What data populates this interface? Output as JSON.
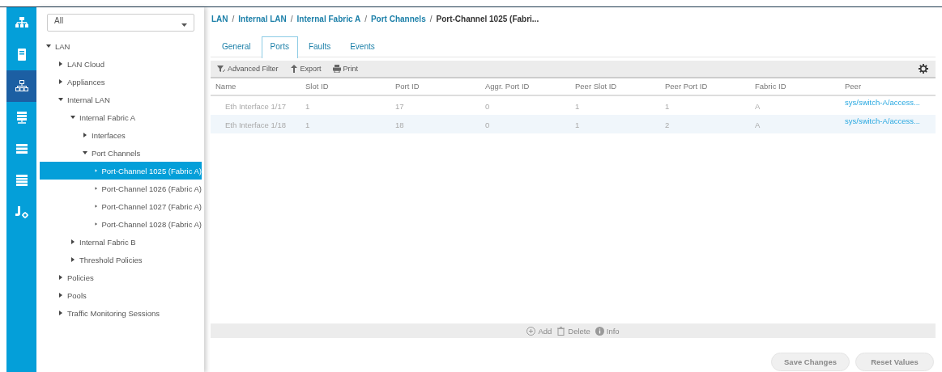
{
  "nav_rail": [
    {
      "selected": false
    },
    {
      "selected": false
    },
    {
      "selected": true
    },
    {
      "selected": false
    },
    {
      "selected": false
    },
    {
      "selected": false
    },
    {
      "selected": false
    }
  ],
  "filter": {
    "value": "All"
  },
  "tree": [
    {
      "label": "LAN",
      "expanded": true,
      "selected": false,
      "children": [
        {
          "label": "LAN Cloud",
          "expanded": false,
          "selected": false
        },
        {
          "label": "Appliances",
          "expanded": false,
          "selected": false
        },
        {
          "label": "Internal LAN",
          "expanded": true,
          "selected": false,
          "children": [
            {
              "label": "Internal Fabric A",
              "expanded": true,
              "selected": false,
              "children": [
                {
                  "label": "Interfaces",
                  "expanded": false,
                  "selected": false
                },
                {
                  "label": "Port Channels",
                  "expanded": true,
                  "selected": false,
                  "children": [
                    {
                      "label": "Port-Channel 1025 (Fabric A)",
                      "expanded": false,
                      "selected": true
                    },
                    {
                      "label": "Port-Channel 1026 (Fabric A)",
                      "expanded": false,
                      "selected": false
                    },
                    {
                      "label": "Port-Channel 1027 (Fabric A)",
                      "expanded": false,
                      "selected": false
                    },
                    {
                      "label": "Port-Channel 1028 (Fabric A)",
                      "expanded": false,
                      "selected": false
                    }
                  ]
                }
              ]
            },
            {
              "label": "Internal Fabric B",
              "expanded": false,
              "selected": false
            },
            {
              "label": "Threshold Policies",
              "expanded": false,
              "selected": false
            }
          ]
        },
        {
          "label": "Policies",
          "expanded": false,
          "selected": false
        },
        {
          "label": "Pools",
          "expanded": false,
          "selected": false
        },
        {
          "label": "Traffic Monitoring Sessions",
          "expanded": false,
          "selected": false
        }
      ]
    }
  ],
  "breadcrumb": [
    {
      "label": "LAN",
      "current": false
    },
    {
      "label": "Internal LAN",
      "current": false
    },
    {
      "label": "Internal Fabric A",
      "current": false
    },
    {
      "label": "Port Channels",
      "current": false
    },
    {
      "label": "Port-Channel 1025 (Fabri...",
      "current": true
    }
  ],
  "breadcrumb_separator": "/",
  "tabs": [
    {
      "label": "General",
      "selected": false
    },
    {
      "label": "Ports",
      "selected": true
    },
    {
      "label": "Faults",
      "selected": false
    },
    {
      "label": "Events",
      "selected": false
    }
  ],
  "toolbar": [
    {
      "kind": "filter",
      "label": "Advanced Filter"
    },
    {
      "kind": "export",
      "label": "Export"
    },
    {
      "kind": "print",
      "label": "Print"
    }
  ],
  "table": {
    "columns": [
      "Name",
      "Slot ID",
      "Port ID",
      "Aggr. Port ID",
      "Peer Slot ID",
      "Peer Port ID",
      "Fabric ID",
      "Peer"
    ],
    "rows": [
      [
        "Eth Interface 1/17",
        "1",
        "17",
        "0",
        "1",
        "1",
        "A",
        "sys/switch-A/access..."
      ],
      [
        "Eth Interface 1/18",
        "1",
        "18",
        "0",
        "1",
        "2",
        "A",
        "sys/switch-A/access..."
      ]
    ]
  },
  "table_actions": [
    {
      "kind": "add",
      "label": "Add",
      "disabled": true
    },
    {
      "kind": "delete",
      "label": "Delete",
      "disabled": true
    },
    {
      "kind": "info",
      "label": "Info",
      "disabled": true
    }
  ],
  "buttons": [
    {
      "label": "Save Changes",
      "disabled": true
    },
    {
      "label": "Reset Values",
      "disabled": true
    }
  ]
}
